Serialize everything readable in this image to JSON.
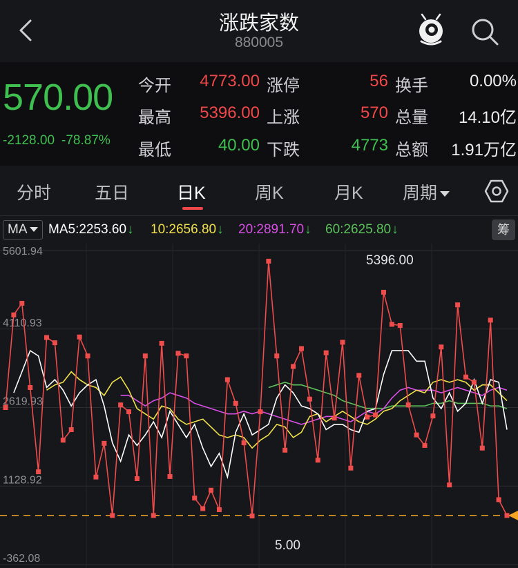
{
  "header": {
    "title": "涨跌家数",
    "code": "880005"
  },
  "quote": {
    "price": "570.00",
    "change": "-2128.00",
    "change_pct": "-78.87%",
    "stats": [
      {
        "label": "今开",
        "value": "4773.00",
        "color": "red"
      },
      {
        "label": "涨停",
        "value": "56",
        "color": "red"
      },
      {
        "label": "换手",
        "value": "0.00%",
        "color": "white"
      },
      {
        "label": "最高",
        "value": "5396.00",
        "color": "red"
      },
      {
        "label": "上涨",
        "value": "570",
        "color": "red"
      },
      {
        "label": "总量",
        "value": "14.10亿",
        "color": "white"
      },
      {
        "label": "最低",
        "value": "40.00",
        "color": "green"
      },
      {
        "label": "下跌",
        "value": "4773",
        "color": "green"
      },
      {
        "label": "总额",
        "value": "1.91万亿",
        "color": "white"
      }
    ]
  },
  "tabs": [
    {
      "label": "分时"
    },
    {
      "label": "五日"
    },
    {
      "label": "日K",
      "active": true
    },
    {
      "label": "周K"
    },
    {
      "label": "月K"
    },
    {
      "label": "周期"
    }
  ],
  "ma": {
    "selector": "MA",
    "items": [
      {
        "label": "MA5:",
        "value": "2253.60",
        "color": "#ffffff"
      },
      {
        "label": "10:",
        "value": "2656.80",
        "color": "#f0e14a"
      },
      {
        "label": "20:",
        "value": "2891.70",
        "color": "#d94fe6"
      },
      {
        "label": "60:",
        "value": "2625.80",
        "color": "#5cc25a"
      }
    ],
    "arrow": "↓",
    "chip": "筹"
  },
  "chart_data": {
    "type": "line",
    "y_tick_labels": [
      "5601.94",
      "4110.93",
      "2619.93",
      "1128.92",
      "-362.08"
    ],
    "ylim": [
      -362.08,
      5601.94
    ],
    "max_label": "5396.00",
    "min_label": "5.00",
    "last_value": 570,
    "colors": {
      "main": "#ef4c4c",
      "ma5": "#ffffff",
      "ma10": "#f0e14a",
      "ma20": "#d94fe6",
      "ma60": "#5cc25a",
      "last": "#f5a623"
    },
    "series": [
      {
        "key": "main",
        "values": [
          2620,
          4380,
          4600,
          3000,
          1400,
          3950,
          3850,
          2000,
          2200,
          3960,
          3600,
          1300,
          1940,
          570,
          2670,
          2540,
          1270,
          3600,
          570,
          3840,
          1310,
          3650,
          3600,
          900,
          700,
          1050,
          680,
          3150,
          2700,
          1950,
          560,
          2540,
          5400,
          3600,
          1810,
          3400,
          3740,
          2780,
          1620,
          3660,
          2420,
          3860,
          1470,
          3230,
          2440,
          2480,
          4810,
          4200,
          4180,
          2670,
          2100,
          1900,
          2460,
          3770,
          1150,
          4570,
          3200,
          3100,
          1850,
          4280,
          870,
          570
        ]
      },
      {
        "key": "ma5",
        "values": [
          2900,
          3300,
          3700,
          3600,
          3000,
          3150,
          2950,
          2650,
          2900,
          3050,
          3150,
          2650,
          1950,
          1600,
          2100,
          1900,
          2100,
          2350,
          2050,
          2550,
          2300,
          2050,
          2300,
          1850,
          1500,
          1750,
          1300,
          2150,
          2500,
          2100,
          2200,
          2300,
          2800,
          3050,
          2900,
          2650,
          2600,
          2500,
          2200,
          2300,
          2300,
          2200,
          2150,
          2550,
          2600,
          3250,
          3700,
          3700,
          3700,
          3500,
          3500,
          2800,
          2600,
          2900,
          2550,
          2700,
          3150,
          2700,
          3150,
          3100,
          2200
        ]
      },
      {
        "key": "ma10",
        "values": [
          2950,
          3050,
          3100,
          3300,
          3150,
          3050,
          3000,
          2850,
          3100,
          3200,
          2950,
          2600,
          2500,
          2400,
          2650,
          2600,
          2400,
          2300,
          2350,
          2400,
          2250,
          2100,
          2050,
          2100,
          2050,
          1850,
          2000,
          2100,
          2300,
          2250,
          2050,
          2150,
          2450,
          2500,
          2350,
          2450,
          2550,
          2450,
          2350,
          2300,
          2400,
          2550,
          2600,
          2750,
          2850,
          2950,
          2900,
          3100,
          3150,
          3100,
          3150,
          3100,
          2950,
          3050,
          3050,
          2900,
          2750
        ]
      },
      {
        "key": "ma20",
        "values": [
          2850,
          2850,
          2750,
          2650,
          2750,
          2800,
          2900,
          2850,
          2800,
          2700,
          2650,
          2600,
          2550,
          2500,
          2500,
          2550,
          2500,
          2550,
          2500,
          2450,
          2400,
          2350,
          2300,
          2350,
          2400,
          2450,
          2450,
          2400,
          2350,
          2450,
          2550,
          2500,
          2600,
          2800,
          2950,
          3000,
          2950,
          2950,
          2950,
          2900,
          2950,
          3000,
          2950,
          2900,
          2850,
          2950,
          3000,
          2950
        ]
      },
      {
        "key": "ma60",
        "values": [
          3000,
          3050,
          3100,
          3050,
          3050,
          3000,
          2950,
          2900,
          2850,
          2750,
          2700,
          2650,
          2600,
          2600,
          2600,
          2650,
          2650,
          2650,
          2650,
          2650,
          2700,
          2700,
          2750,
          2700,
          2700,
          2700,
          2700,
          2650,
          2650,
          2600
        ]
      }
    ]
  }
}
